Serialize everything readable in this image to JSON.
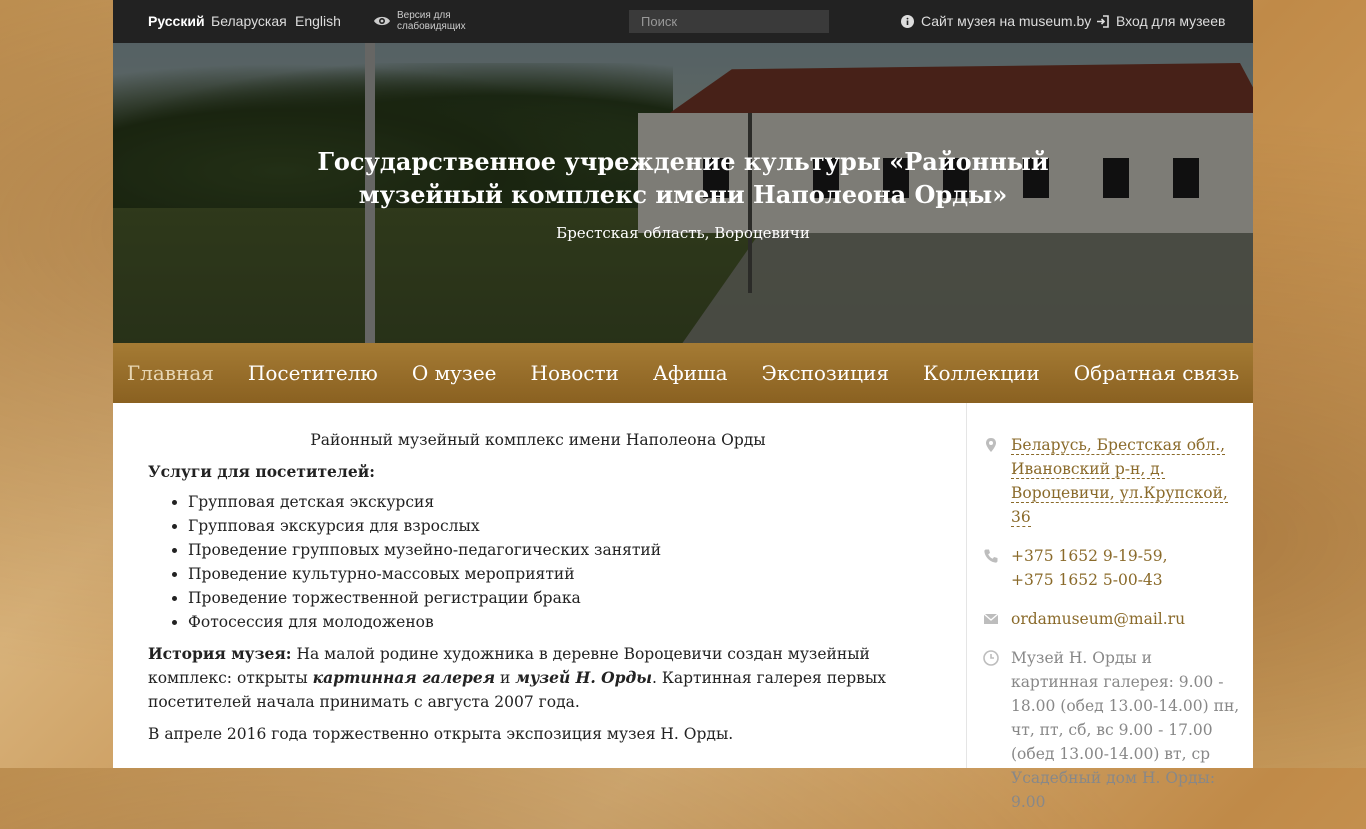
{
  "topbar": {
    "languages": [
      "Русский",
      "Беларуская",
      "English"
    ],
    "low_vision_label": "Версия для слабовидящих",
    "search_placeholder": "Поиск",
    "site_link": "Сайт музея на museum.by",
    "login_link": "Вход для музеев"
  },
  "hero": {
    "title": "Государственное учреждение культуры «Районный музейный комплекс имени Наполеона Орды»",
    "subtitle": "Брестская область, Вороцевичи"
  },
  "nav": {
    "items": [
      "Главная",
      "Посетителю",
      "О музее",
      "Новости",
      "Афиша",
      "Экспозиция",
      "Коллекции",
      "Обратная связь"
    ],
    "active": "Главная"
  },
  "content": {
    "intro": "Районный музейный комплекс имени Наполеона Орды",
    "services_heading": "Услуги для посетителей:",
    "services": [
      "Групповая детская экскурсия",
      "Групповая экскурсия для взрослых",
      "Проведение групповых музейно-педагогических занятий",
      "Проведение культурно-массовых мероприятий",
      "Проведение торжественной регистрации брака",
      "Фотосессия для молодоженов"
    ],
    "history_label": "История музея:",
    "history_text_1": " На малой родине художника в деревне Вороцевичи создан музейный комплекс: открыты ",
    "history_em_1": "картинная галерея",
    "history_text_2": " и ",
    "history_em_2": "музей Н. Орды",
    "history_text_3": ". Картинная галерея первых посетителей начала принимать с августа 2007 года.",
    "history_2": "В апреле 2016 года торжественно открыта экспозиция музея Н. Орды."
  },
  "sidebar": {
    "address": "Беларусь, Брестская обл., Ивановский р-н, д. Вороцевичи, ул.Крупской, 36",
    "phone_1": "+375 1652 9-19-59,",
    "phone_2": "+375 1652 5-00-43",
    "email": "ordamuseum@mail.ru",
    "hours": "Музей Н. Орды и картинная галерея: 9.00 - 18.00 (обед 13.00-14.00) пн, чт, пт, сб, вс 9.00 - 17.00 (обед 13.00-14.00) вт, ср Усадебный дом Н. Орды: 9.00"
  },
  "colors": {
    "accent": "#8a6121",
    "topbar": "#222222",
    "link": "#8a6a2a"
  }
}
